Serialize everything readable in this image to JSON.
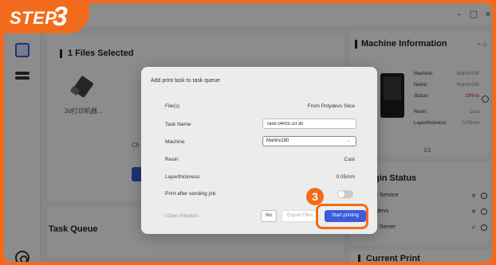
{
  "step_badge": {
    "word": "STEP",
    "number": "3"
  },
  "window_controls": {
    "minimize": "–",
    "maximize": "□",
    "close": "×"
  },
  "files": {
    "title": "1 Files Selected",
    "file_name": "3d打印机器...",
    "hint": "Cli"
  },
  "queue": {
    "title": "Task Queue"
  },
  "machine_info": {
    "title": "Machine Information",
    "machine_label": "Machine:",
    "machine_value": "Martrix190",
    "name_label": "Name:",
    "name_value": "Martrix190",
    "status_label": "Status:",
    "status_value": "Offline",
    "resin_label": "Resin:",
    "resin_value": "Cast",
    "layer_label": "Layerthickness:",
    "layer_value": "0.05mm",
    "pager": "1/1"
  },
  "login_status": {
    "title": "gin Status",
    "services": [
      "C Service",
      "ydevs",
      "E Server"
    ]
  },
  "current_print": {
    "title": "Current Print"
  },
  "dialog": {
    "title": "Add print task to task queue",
    "files_label": "File(s)",
    "files_value": "From Polydevs Slice",
    "task_name_label": "Task Name",
    "task_name_value": "Task-04/03-10:30",
    "machine_label": "Machine",
    "machine_value": "Martrix190",
    "resin_label": "Resin",
    "resin_value": "Cast",
    "layer_label": "Layerthickness",
    "layer_value": "0.05mm",
    "print_after_label": "Print after sending job",
    "open_link": "Open Polydevs",
    "no_label": "No",
    "export_label": "Export Files",
    "start_label": "Start printing"
  },
  "callout": {
    "number": "3"
  },
  "colors": {
    "accent": "#f26b1d",
    "primary": "#3b5bdb",
    "offline": "#e03131"
  }
}
